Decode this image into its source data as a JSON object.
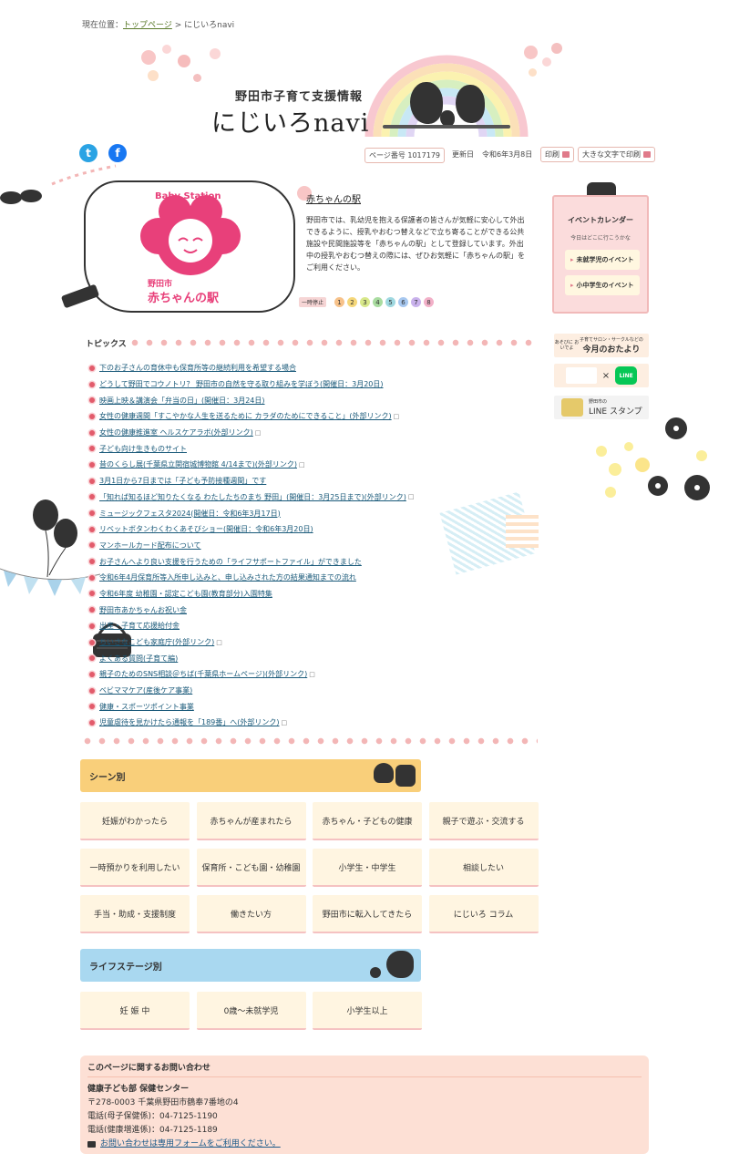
{
  "breadcrumb": {
    "prefix": "現在位置：",
    "home": "トップページ",
    "sep": " > ",
    "current": "にじいろnavi"
  },
  "header": {
    "subtitle": "野田市子育て支援情報",
    "title": "にじいろnavi"
  },
  "toolbar": {
    "page_no_label": "ページ番号 1017179",
    "updated_label": "更新日",
    "updated_date": "令和6年3月8日",
    "print_label": "印刷",
    "large_print_label": "大きな文字で印刷"
  },
  "station": {
    "logo_top": "Baby Station",
    "logo_city": "野田市",
    "logo_name": "赤ちゃんの駅",
    "title": "赤ちゃんの駅",
    "description": "野田市では、乳幼児を抱える保護者の皆さんが気軽に安心して外出できるように、授乳やおむつ替えなどで立ち寄ることができる公共施設や民間施設等を「赤ちゃんの駅」として登録しています。外出中の授乳やおむつ替えの際には、ぜひお気軽に「赤ちゃんの駅」をご利用ください。",
    "pause_label": "一時停止",
    "pages": [
      "1",
      "2",
      "3",
      "4",
      "5",
      "6",
      "7",
      "8"
    ],
    "page_colors": [
      "#f7c28a",
      "#f5d77a",
      "#d8e88a",
      "#a9dca0",
      "#9fd8e0",
      "#a7c8f0",
      "#c9b2ec",
      "#f2b0c8"
    ]
  },
  "calendar": {
    "title": "イベントカレンダー",
    "subtitle": "今日はどこに行こうかな",
    "btn_preschool": "未就学児のイベント",
    "btn_school": "小中学生のイベント"
  },
  "banners": {
    "monthly_small": "子育てサロン・サークルなどの",
    "monthly_small2": "あそびに おいでよ",
    "monthly": "今月のおたより",
    "line_x": "×",
    "line_logo": "LINE",
    "stamp_small": "野田市の",
    "stamp": "LINE スタンプ"
  },
  "topics": {
    "heading": "トピックス",
    "items": [
      {
        "text": "下のお子さんの育休中も保育所等の継続利用を希望する場合",
        "ext": ""
      },
      {
        "text": "どうして野田でコウノトリ？ 野田市の自然を守る取り組みを学ぼう(開催日：3月20日)",
        "ext": ""
      },
      {
        "text": "映画上映＆講演会「弁当の日」(開催日：3月24日)",
        "ext": ""
      },
      {
        "text": "女性の健康週間「すこやかな人生を送るために カラダのためにできること」(外部リンク)",
        "ext": "□"
      },
      {
        "text": "女性の健康推進室 ヘルスケアラボ(外部リンク)",
        "ext": "□"
      },
      {
        "text": "子ども向け生きものサイト",
        "ext": ""
      },
      {
        "text": "昔のくらし展(千葉県立関宿城博物館 4/14まで)(外部リンク)",
        "ext": "□"
      },
      {
        "text": "3月1日から7日までは「子ども予防接種週間」です",
        "ext": ""
      },
      {
        "text": "「知れば知るほど知りたくなる わたしたちのまち 野田」(開催日：3月25日まで)(外部リンク)",
        "ext": "□"
      },
      {
        "text": "ミュージックフェスタ2024(開催日：令和6年3月17日)",
        "ext": ""
      },
      {
        "text": "リベットボタンわくわくあそびショー(開催日：令和6年3月20日)",
        "ext": ""
      },
      {
        "text": "マンホールカード配布について",
        "ext": ""
      },
      {
        "text": "お子さんへより良い支援を行うための「ライフサポートファイル」ができました",
        "ext": ""
      },
      {
        "text": "令和6年4月保育所等入所申し込みと、申し込みされた方の結果通知までの流れ",
        "ext": ""
      },
      {
        "text": "令和6年度 幼稚園・認定こども園(教育部分)入園特集",
        "ext": ""
      },
      {
        "text": "野田市あかちゃんお祝い金",
        "ext": ""
      },
      {
        "text": "出産・子育て応援給付金",
        "ext": ""
      },
      {
        "text": "ちいさなこども家庭庁(外部リンク)",
        "ext": "□"
      },
      {
        "text": "よくある質問(子育て編)",
        "ext": ""
      },
      {
        "text": "親子のためのSNS相談＠ちば(千葉県ホームページ)(外部リンク)",
        "ext": "□"
      },
      {
        "text": "ベビママケア(産後ケア事業)",
        "ext": ""
      },
      {
        "text": "健康・スポーツポイント事業",
        "ext": ""
      },
      {
        "text": "児童虐待を見かけたら通報を「189番」へ(外部リンク)",
        "ext": "□"
      }
    ]
  },
  "scenes": {
    "heading": "シーン別",
    "buttons": [
      "妊娠がわかったら",
      "赤ちゃんが産まれたら",
      "赤ちゃん・子どもの健康",
      "親子で遊ぶ・交流する",
      "一時預かりを利用したい",
      "保育所・こども園・幼稚園",
      "小学生・中学生",
      "相談したい",
      "手当・助成・支援制度",
      "働きたい方",
      "野田市に転入してきたら",
      "にじいろ コラム"
    ]
  },
  "lifestage": {
    "heading": "ライフステージ別",
    "buttons": [
      "妊 娠 中",
      "0歳～未就学児",
      "小学生以上"
    ]
  },
  "contact": {
    "title": "このページに関するお問い合わせ",
    "dept": "健康子ども部 保健センター",
    "address": "〒278-0003 千葉県野田市鶴奉7番地の4",
    "tel1": "電話(母子保健係)：04-7125-1190",
    "tel2": "電話(健康増進係)：04-7125-1189",
    "form_link": "お問い合わせは専用フォームをご利用ください。"
  },
  "colors": {
    "accent_pink": "#e25b6b",
    "scene_band": "#f9cf7a",
    "lifestage_band": "#a9d8f0",
    "contact_bg": "#fde0d5"
  }
}
